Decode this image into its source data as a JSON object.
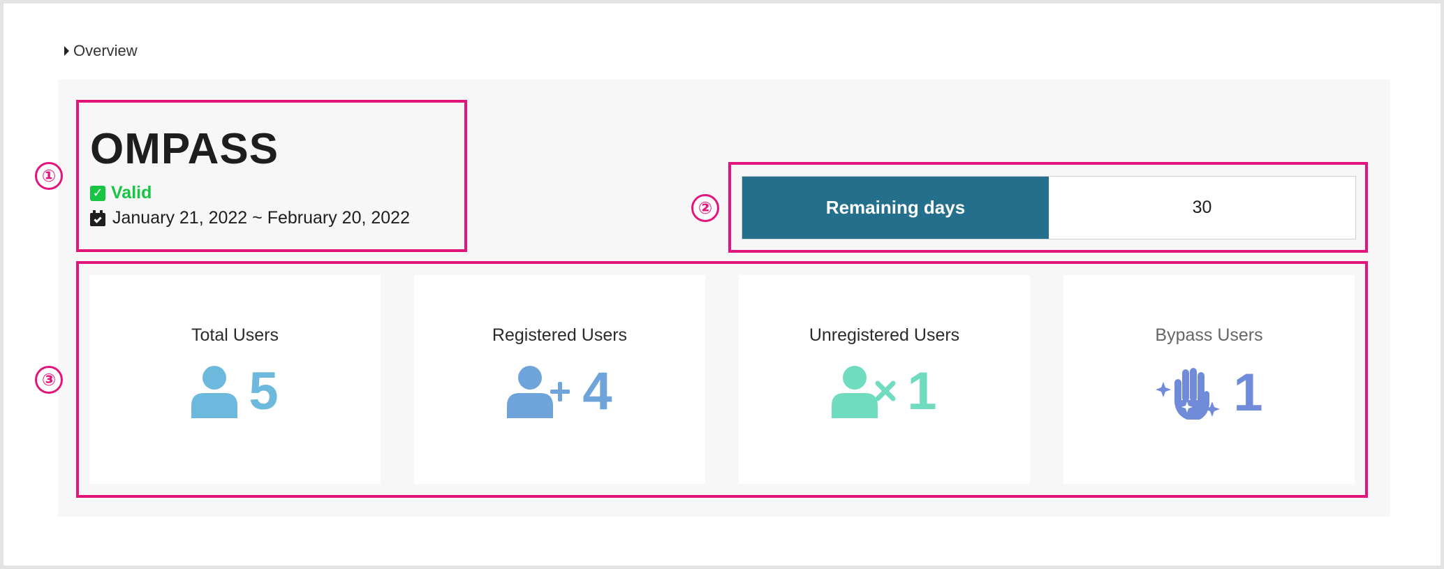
{
  "breadcrumb": {
    "label": "Overview"
  },
  "markers": {
    "m1": "①",
    "m2": "②",
    "m3": "③"
  },
  "license": {
    "name": "OMPASS",
    "status": "Valid",
    "period": "January 21, 2022 ~ February 20, 2022"
  },
  "remaining": {
    "label": "Remaining days",
    "value": "30"
  },
  "stats": [
    {
      "label": "Total Users",
      "value": "5",
      "icon": "user-icon",
      "color": "#6cb9dd"
    },
    {
      "label": "Registered Users",
      "value": "4",
      "icon": "user-plus-icon",
      "color": "#6ea4d9"
    },
    {
      "label": "Unregistered Users",
      "value": "1",
      "icon": "user-x-icon",
      "color": "#6fdcc0"
    },
    {
      "label": "Bypass Users",
      "value": "1",
      "icon": "hand-sparkle-icon",
      "color": "#6f8bd9"
    }
  ],
  "colors": {
    "accent": "#246f8c",
    "valid": "#17c443",
    "highlight": "#e3157d"
  }
}
